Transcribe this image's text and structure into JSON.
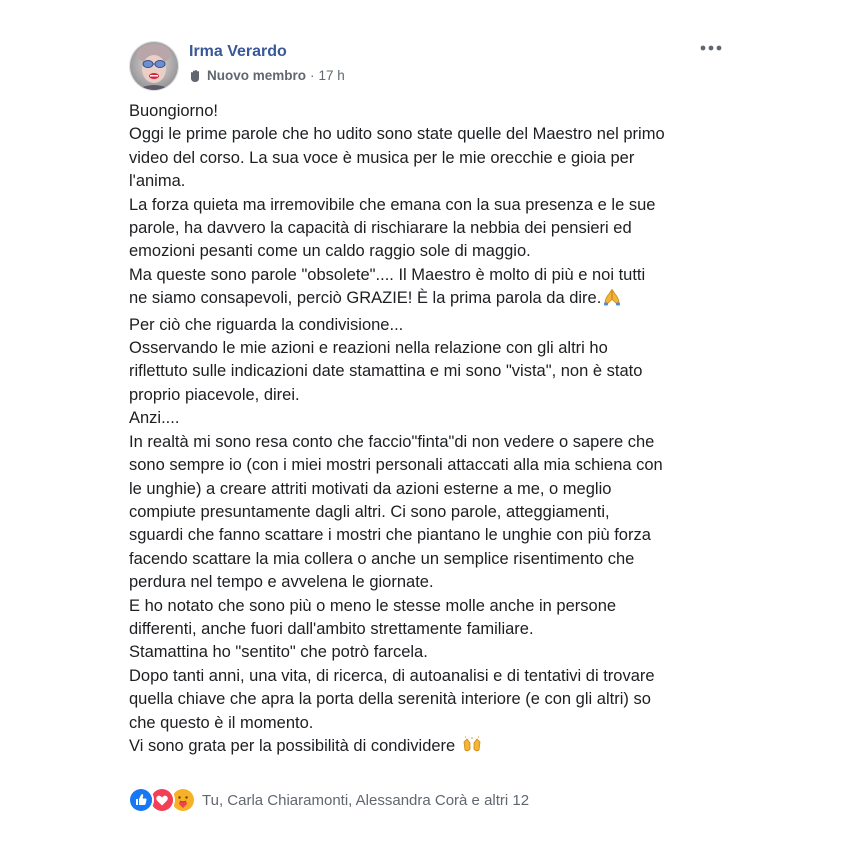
{
  "author": {
    "name": "Irma Verardo",
    "badge": "Nuovo membro",
    "badge_icon": "waving-hand-icon",
    "separator": "·",
    "time": "17 h"
  },
  "more_menu": {
    "icon": "more-options-icon"
  },
  "post": {
    "lines": [
      "Buongiorno!",
      "Oggi le prime parole che ho udito sono state quelle del Maestro nel primo",
      "video del corso. La sua voce è musica per le mie orecchie e gioia per",
      "l'anima.",
      "La forza quieta ma irremovibile che emana con la sua presenza e le sue",
      "parole, ha davvero la capacità di rischiarare la nebbia dei pensieri ed",
      "emozioni pesanti come un caldo raggio sole di maggio.",
      "Ma queste sono parole \"obsolete\".... Il Maestro è molto di più e noi tutti",
      "ne siamo consapevoli, perciò GRAZIE! È la prima parola da dire.",
      "Per ciò che riguarda la condivisione...",
      "Osservando le mie azioni e reazioni nella relazione con gli altri ho",
      "riflettuto sulle indicazioni date stamattina e mi sono \"vista\", non è stato",
      "proprio piacevole, direi.",
      "Anzi....",
      "In realtà mi sono resa conto che faccio\"finta\"di non vedere o sapere che",
      "sono sempre io (con i miei mostri personali attaccati alla mia schiena con",
      "le unghie) a creare attriti motivati da azioni esterne a me, o meglio",
      "compiute presuntamente dagli altri. Ci sono parole, atteggiamenti,",
      "sguardi che fanno scattare i mostri che piantano le unghie con più forza",
      "facendo scattare la mia collera o anche un semplice risentimento che",
      "perdura nel tempo e avvelena le giornate.",
      "E ho notato che sono più o meno le stesse molle anche in persone",
      "differenti, anche fuori dall'ambito strettamente familiare.",
      "Stamattina ho \"sentito\" che potrò farcela.",
      "Dopo tanti anni, una vita, di ricerca, di autoanalisi e di tentativi di trovare",
      "quella chiave che apra la porta della serenità interiore (e con gli altri) so",
      "che questo è il momento.",
      "Vi sono grata per la possibilità di condividere"
    ],
    "inline_emojis": {
      "line_8": "folded-hands-icon",
      "line_27": "raising-hands-icon"
    }
  },
  "reactions": {
    "icons": [
      "like-icon",
      "love-icon",
      "care-icon"
    ],
    "text": "Tu, Carla Chiaramonti, Alessandra Corà e altri 12"
  },
  "colors": {
    "name": "#385898",
    "meta": "#606770",
    "text": "#1c1e21",
    "like": "#1877f2",
    "love": "#f33e58",
    "care": "#f7b125"
  }
}
